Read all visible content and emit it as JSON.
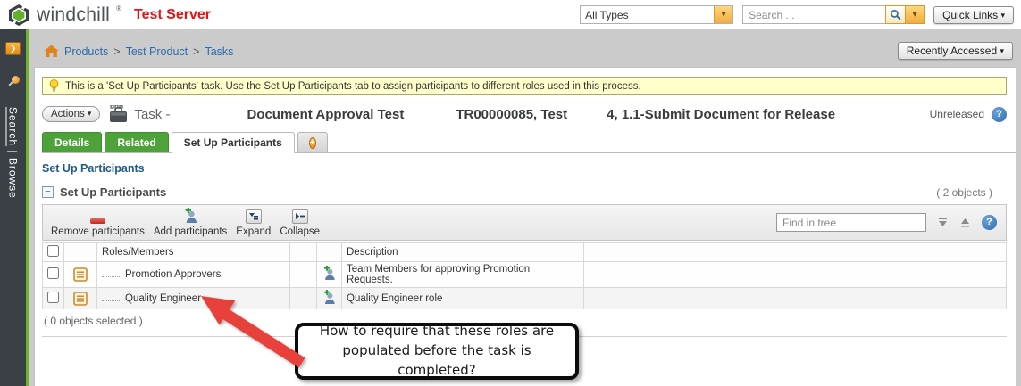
{
  "header": {
    "logo_text": "windchill",
    "logo_reg": "®",
    "server_label": "Test Server",
    "type_filter_value": "All Types",
    "search_placeholder": "Search . . .",
    "quick_links_label": "Quick Links",
    "caret": "▾"
  },
  "sidebar": {
    "nav_search": "Search",
    "nav_divider": " | ",
    "nav_browse": "Browse"
  },
  "breadcrumb": {
    "items": [
      "Products",
      "Test Product",
      "Tasks"
    ],
    "separator": ">"
  },
  "recently_accessed_label": "Recently Accessed",
  "notice": {
    "text": "This is a 'Set Up Participants' task. Use the Set Up Participants tab to assign participants to different roles used in this process."
  },
  "task_header": {
    "actions_label": "Actions",
    "type_label": "Task -",
    "title_parts": [
      "Document Approval Test",
      "TR00000085, Test",
      "4, 1.1-Submit Document for Release"
    ],
    "status": "Unreleased",
    "help_glyph": "?"
  },
  "tabs": {
    "items": [
      "Details",
      "Related",
      "Set Up Participants"
    ],
    "active": "Set Up Participants"
  },
  "page_heading": "Set Up Participants",
  "section": {
    "collapse_glyph": "−",
    "title": "Set Up Participants",
    "object_count": "( 2 objects )"
  },
  "toolbar": {
    "remove_label": "Remove participants",
    "add_label": "Add participants",
    "expand_label": "Expand",
    "collapse_label": "Collapse",
    "find_placeholder": "Find in tree",
    "help_glyph": "?"
  },
  "table": {
    "columns": {
      "roles": "Roles/Members",
      "description": "Description"
    },
    "rows": [
      {
        "name": "Promotion Approvers",
        "description": "Team Members for approving Promotion Requests."
      },
      {
        "name": "Quality Engineer",
        "description": "Quality Engineer role"
      }
    ],
    "footer": "( 0 objects selected )"
  },
  "annotation": {
    "text": "How to require that these roles are populated before the task is completed?"
  },
  "colors": {
    "tab_green": "#4da23a",
    "sidebar_green": "#6fb32b",
    "accent_orange": "#e08a14",
    "arrow_red": "#e8403a",
    "link_blue": "#2a6db0",
    "notice_bg": "#ffffcc",
    "heading_blue": "#1e5b86",
    "server_red": "#e01616"
  }
}
